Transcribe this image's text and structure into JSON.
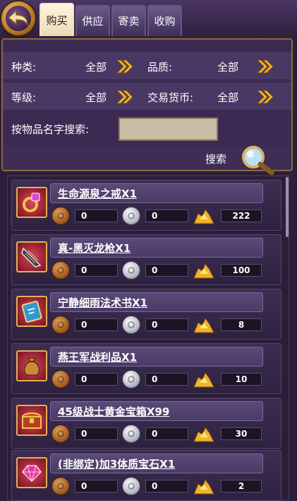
{
  "tabs": [
    {
      "label": "购买",
      "active": true
    },
    {
      "label": "供应",
      "active": false
    },
    {
      "label": "寄卖",
      "active": false
    },
    {
      "label": "收购",
      "active": false
    }
  ],
  "filters": {
    "category_label": "种类:",
    "category_value": "全部",
    "quality_label": "品质:",
    "quality_value": "全部",
    "level_label": "等级:",
    "level_value": "全部",
    "currency_label": "交易货币:",
    "currency_value": "全部",
    "name_search_label": "按物品名字搜索:",
    "name_search_value": "",
    "search_label": "搜索"
  },
  "items": [
    {
      "name": "生命源泉之戒X1",
      "copper": "0",
      "silver": "0",
      "gold": "222",
      "icon": "ring-icon"
    },
    {
      "name": "真-黑灭龙枪X1",
      "copper": "0",
      "silver": "0",
      "gold": "100",
      "icon": "lance-icon"
    },
    {
      "name": "宁静细雨法术书X1",
      "copper": "0",
      "silver": "0",
      "gold": "8",
      "icon": "spellbook-icon"
    },
    {
      "name": "燕王军战利品X1",
      "copper": "0",
      "silver": "0",
      "gold": "10",
      "icon": "loot-bag-icon"
    },
    {
      "name": "45级战士黄金宝箱X99",
      "copper": "0",
      "silver": "0",
      "gold": "30",
      "icon": "treasure-chest-icon"
    },
    {
      "name": "(非绑定)加3体质宝石X1",
      "copper": "0",
      "silver": "0",
      "gold": "2",
      "icon": "gem-icon"
    }
  ],
  "colors": {
    "accent_gold": "#f0b428",
    "panel": "#3b2a52",
    "tab_active": "#f3e6c6"
  }
}
